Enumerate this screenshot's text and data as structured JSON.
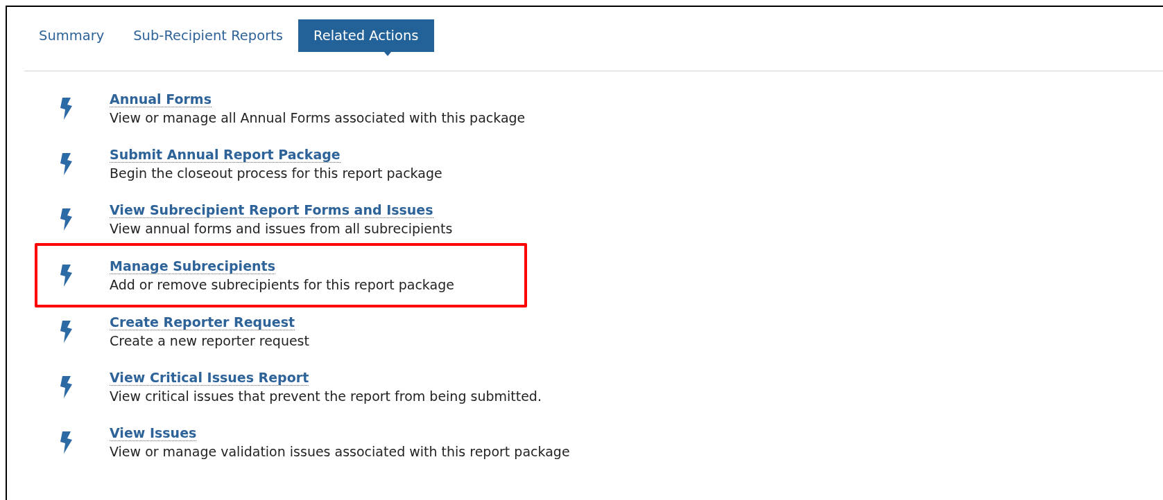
{
  "tabs": [
    {
      "label": "Summary",
      "selected": false
    },
    {
      "label": "Sub-Recipient Reports",
      "selected": false
    },
    {
      "label": "Related Actions",
      "selected": true
    }
  ],
  "actions": [
    {
      "title": "Annual Forms",
      "description": "View or manage all Annual Forms associated with this package",
      "highlighted": false
    },
    {
      "title": "Submit Annual Report Package",
      "description": "Begin the closeout process for this report package",
      "highlighted": false
    },
    {
      "title": "View Subrecipient Report Forms and Issues",
      "description": "View annual forms and issues from all subrecipients",
      "highlighted": false
    },
    {
      "title": "Manage Subrecipients",
      "description": "Add or remove subrecipients for this report package",
      "highlighted": true
    },
    {
      "title": "Create Reporter Request",
      "description": "Create a new reporter request",
      "highlighted": false
    },
    {
      "title": "View Critical Issues Report",
      "description": "View critical issues that prevent the report from being submitted.",
      "highlighted": false
    },
    {
      "title": "View Issues",
      "description": "View or manage validation issues associated with this report package",
      "highlighted": false
    }
  ]
}
